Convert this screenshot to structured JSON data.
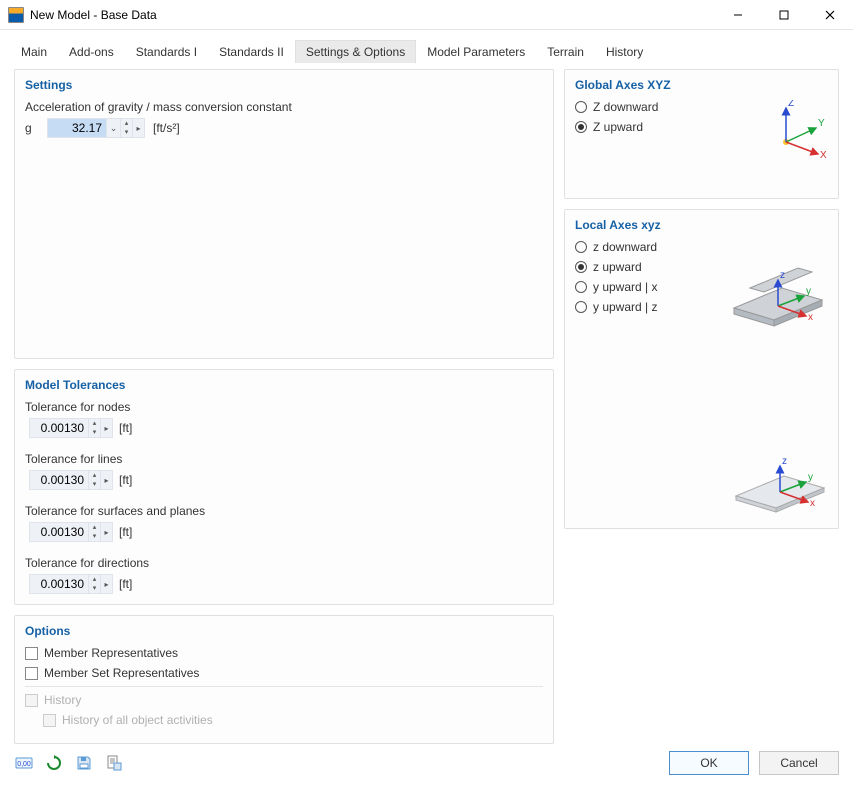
{
  "window": {
    "title": "New Model - Base Data"
  },
  "tabs": [
    {
      "label": "Main"
    },
    {
      "label": "Add-ons"
    },
    {
      "label": "Standards I"
    },
    {
      "label": "Standards II"
    },
    {
      "label": "Settings & Options"
    },
    {
      "label": "Model Parameters"
    },
    {
      "label": "Terrain"
    },
    {
      "label": "History"
    }
  ],
  "settings": {
    "title": "Settings",
    "gravity_label": "Acceleration of gravity / mass conversion constant",
    "gravity_symbol": "g",
    "gravity_value": "32.17",
    "gravity_unit": "[ft/s²]"
  },
  "tolerances": {
    "title": "Model Tolerances",
    "nodes_label": "Tolerance for nodes",
    "nodes_value": "0.00130",
    "lines_label": "Tolerance for lines",
    "lines_value": "0.00130",
    "surfaces_label": "Tolerance for surfaces and planes",
    "surfaces_value": "0.00130",
    "directions_label": "Tolerance for directions",
    "directions_value": "0.00130",
    "unit": "[ft]"
  },
  "options": {
    "title": "Options",
    "member_reps": "Member Representatives",
    "member_set_reps": "Member Set Representatives",
    "history": "History",
    "history_all": "History of all object activities"
  },
  "global_axes": {
    "title": "Global Axes XYZ",
    "opts": [
      "Z downward",
      "Z upward"
    ],
    "labels": {
      "x": "X",
      "y": "Y",
      "z": "Z"
    }
  },
  "local_axes": {
    "title": "Local Axes xyz",
    "opts": [
      "z downward",
      "z upward",
      "y upward | x",
      "y upward | z"
    ],
    "labels": {
      "x": "x",
      "y": "y",
      "z": "z"
    }
  },
  "buttons": {
    "ok": "OK",
    "cancel": "Cancel"
  }
}
